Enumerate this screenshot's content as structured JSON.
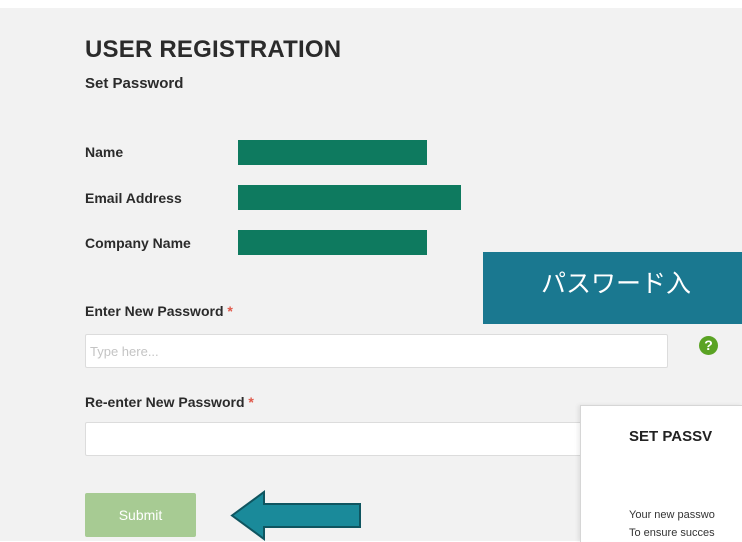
{
  "header": {
    "title": "USER REGISTRATION",
    "subtitle": "Set Password"
  },
  "user_info": {
    "name_label": "Name",
    "email_label": "Email Address",
    "company_label": "Company Name"
  },
  "form": {
    "new_password_label": "Enter New Password",
    "new_password_placeholder": "Type here...",
    "reenter_password_label": "Re-enter New Password",
    "required_mark": "*",
    "help_icon_glyph": "?",
    "submit_label": "Submit"
  },
  "overlay": {
    "banner_text": "パスワード入",
    "modal_title": "SET PASSV",
    "modal_line1": "Your new passwo",
    "modal_line2": "To ensure succes"
  },
  "colors": {
    "redaction": "#0e7a5f",
    "banner": "#1a7890",
    "arrow": "#1a8a9a",
    "submit_disabled": "#a7cb93",
    "help_icon": "#5aa324",
    "required": "#e0584a"
  }
}
